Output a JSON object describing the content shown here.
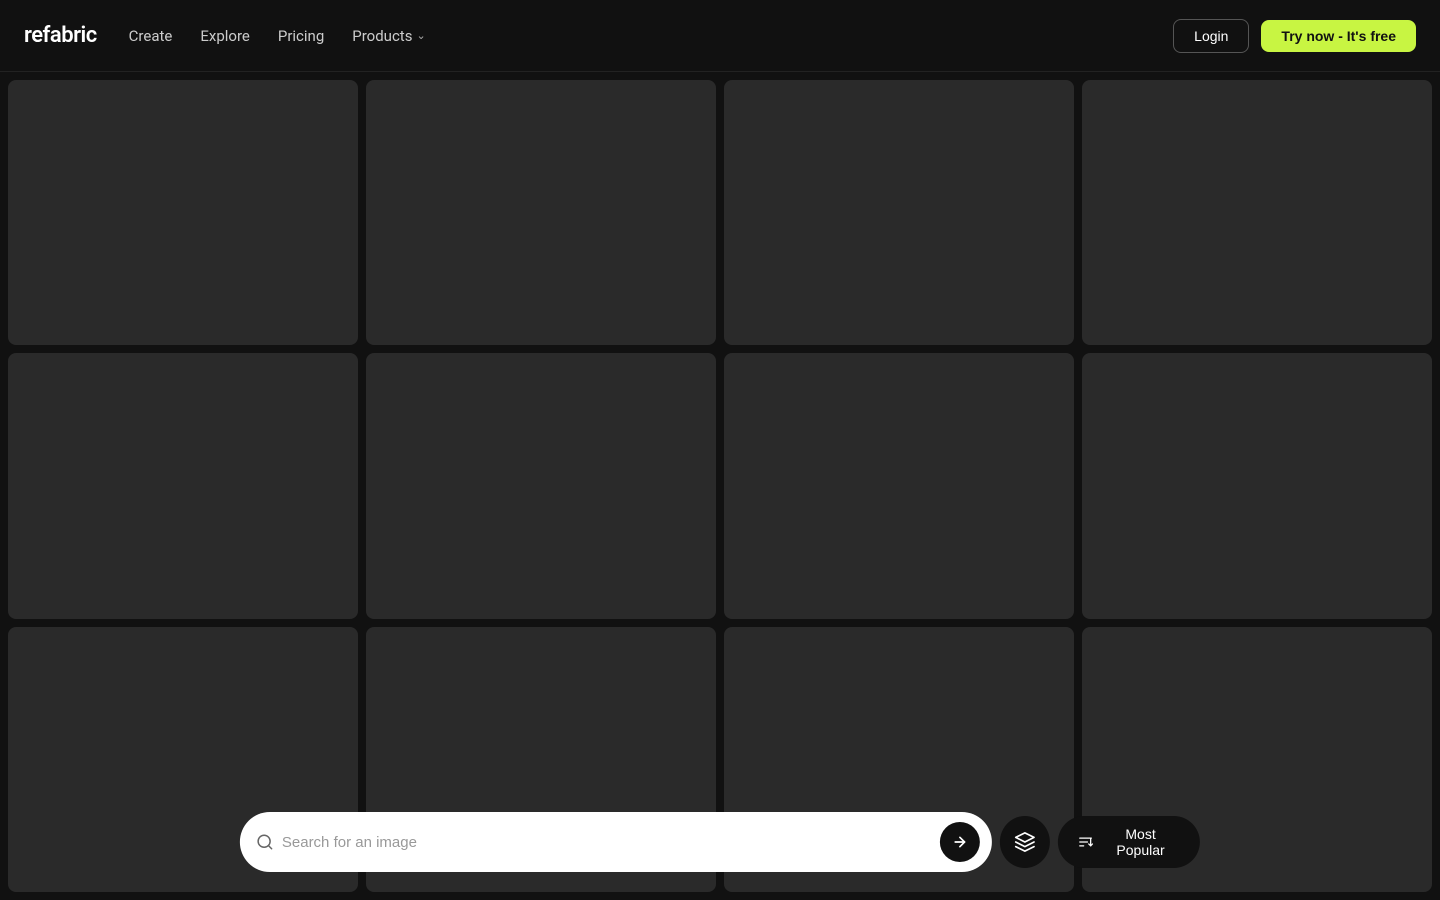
{
  "header": {
    "logo": "refabric",
    "nav": [
      {
        "label": "Create",
        "has_dropdown": false
      },
      {
        "label": "Explore",
        "has_dropdown": false
      },
      {
        "label": "Pricing",
        "has_dropdown": false
      },
      {
        "label": "Products",
        "has_dropdown": true
      }
    ],
    "login_label": "Login",
    "try_label": "Try now - It's free"
  },
  "grid": {
    "items": [
      {
        "id": 1
      },
      {
        "id": 2
      },
      {
        "id": 3
      },
      {
        "id": 4
      },
      {
        "id": 5
      },
      {
        "id": 6
      },
      {
        "id": 7
      },
      {
        "id": 8
      },
      {
        "id": 9
      },
      {
        "id": 10
      },
      {
        "id": 11
      },
      {
        "id": 12
      }
    ]
  },
  "search": {
    "placeholder": "Search for an image"
  },
  "sort": {
    "label": "Most Popular"
  },
  "icons": {
    "search": "🔍",
    "arrow_right": "→",
    "layers": "⊞",
    "sort": "⇅"
  }
}
